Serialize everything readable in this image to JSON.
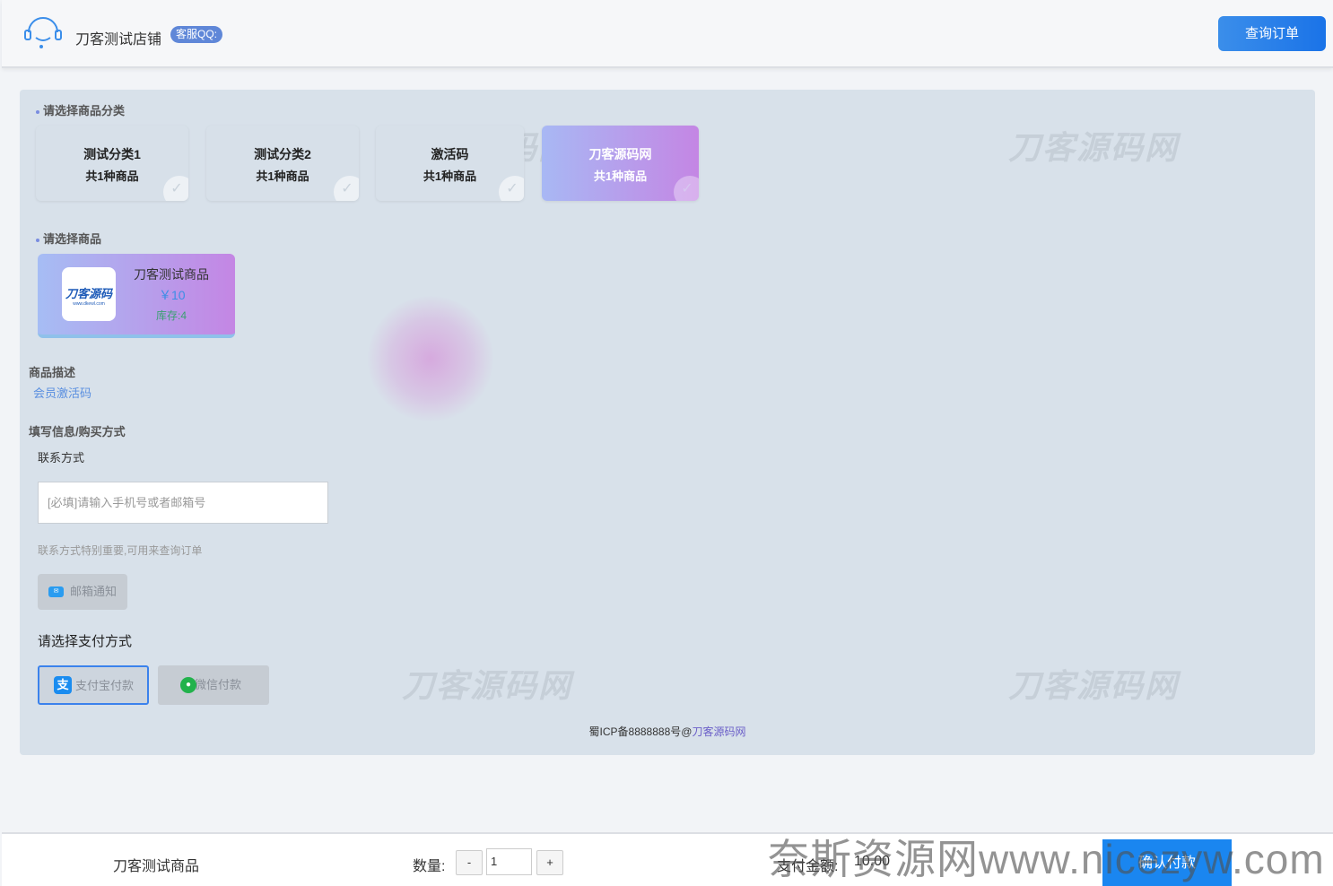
{
  "header": {
    "shop_name": "刀客测试店铺",
    "qq_badge": "客服QQ:",
    "query_button": "查询订单"
  },
  "watermark": "刀客源码网",
  "categories": {
    "title": "请选择商品分类",
    "items": [
      {
        "name": "测试分类1",
        "count": "共1种商品",
        "active": false
      },
      {
        "name": "测试分类2",
        "count": "共1种商品",
        "active": false
      },
      {
        "name": "激活码",
        "count": "共1种商品",
        "active": false
      },
      {
        "name": "刀客源码网",
        "count": "共1种商品",
        "active": true
      }
    ]
  },
  "products": {
    "title": "请选择商品",
    "items": [
      {
        "logo_text": "刀客源码",
        "logo_url_text": "www.dkewl.com",
        "name": "刀客测试商品",
        "price": "￥10",
        "stock": "库存:4"
      }
    ]
  },
  "description": {
    "title": "商品描述",
    "value": "会员激活码"
  },
  "form": {
    "title": "填写信息/购买方式",
    "contact_label": "联系方式",
    "contact_placeholder": "[必填]请输入手机号或者邮箱号",
    "hint": "联系方式特别重要,可用来查询订单",
    "email_button": "邮箱通知",
    "payment_title": "请选择支付方式",
    "alipay_button": "支付宝付款",
    "wechat_button": "微信付款"
  },
  "footer": {
    "icp": "蜀ICP备8888888号@",
    "link": "刀客源码网"
  },
  "bottom_bar": {
    "product_name": "刀客测试商品",
    "qty_label": "数量:",
    "minus": "-",
    "qty_value": "1",
    "plus": "+",
    "amount_label": "支付金额:",
    "amount_value": "10.00",
    "confirm_button": "确认付款"
  },
  "site_watermark": "奈斯资源网www.nicezyw.com",
  "colors": {
    "accent": "#1a86f0",
    "panel_bg": "#d8e1ea",
    "active_gradient_start": "#a8b8f4",
    "active_gradient_end": "#c486e4"
  }
}
